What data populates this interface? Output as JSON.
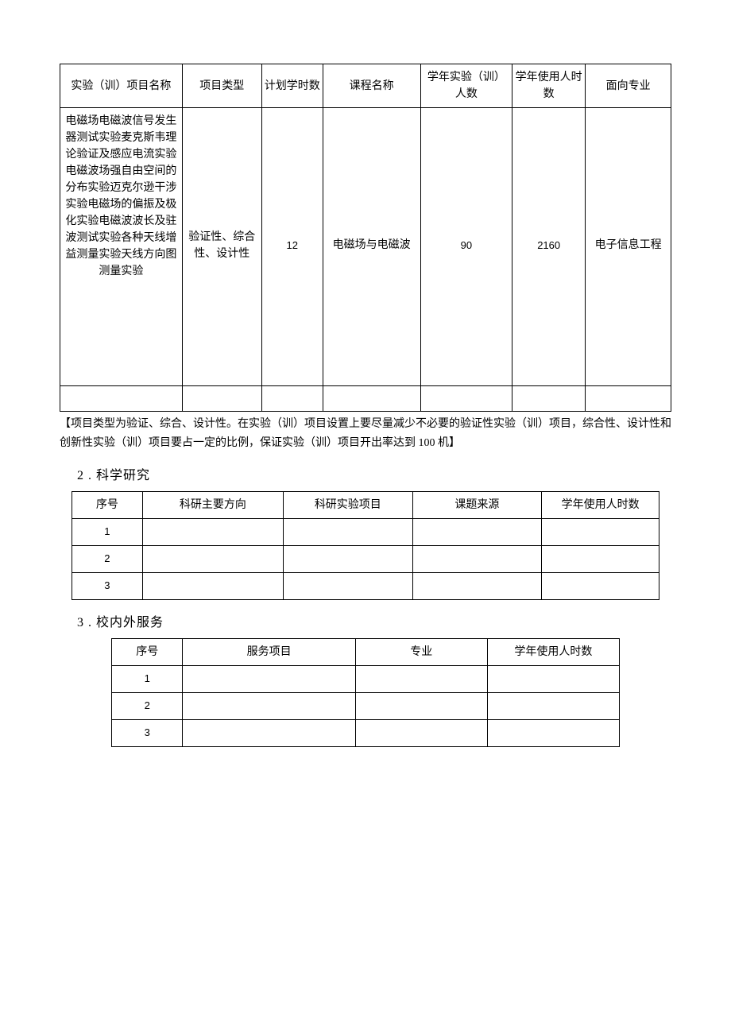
{
  "table1": {
    "headers": [
      "实验（训）项目名称",
      "项目类型",
      "计划学时数",
      "课程名称",
      "学年实验（训）人数",
      "学年使用人时数",
      "面向专业"
    ],
    "row": {
      "name": "电磁场电磁波信号发生器测试实验麦克斯韦理论验证及感应电流实验电磁波场强自由空间的分布实验迈克尔逊干涉实验电磁场的偏振及极化实验电磁波波长及驻波测试实验各种天线增益测量实验天线方向图测量实验",
      "type": "验证性、综合性、设计性",
      "hours": "12",
      "course": "电磁场与电磁波",
      "people": "90",
      "person_hours": "2160",
      "major": "电子信息工程"
    }
  },
  "note": "【项目类型为验证、综合、设计性。在实验（训）项目设置上要尽量减少不必要的验证性实验（训）项目，综合性、设计性和创新性实验（训）项目要占一定的比例，保证实验（训）项目开出率达到 100 机】",
  "section2": {
    "title": "2 . 科学研究",
    "headers": [
      "序号",
      "科研主要方向",
      "科研实验项目",
      "课题来源",
      "学年使用人时数"
    ],
    "rows": [
      "1",
      "2",
      "3"
    ]
  },
  "section3": {
    "title": "3 . 校内外服务",
    "headers": [
      "序号",
      "服务项目",
      "专业",
      "学年使用人时数"
    ],
    "rows": [
      "1",
      "2",
      "3"
    ]
  }
}
